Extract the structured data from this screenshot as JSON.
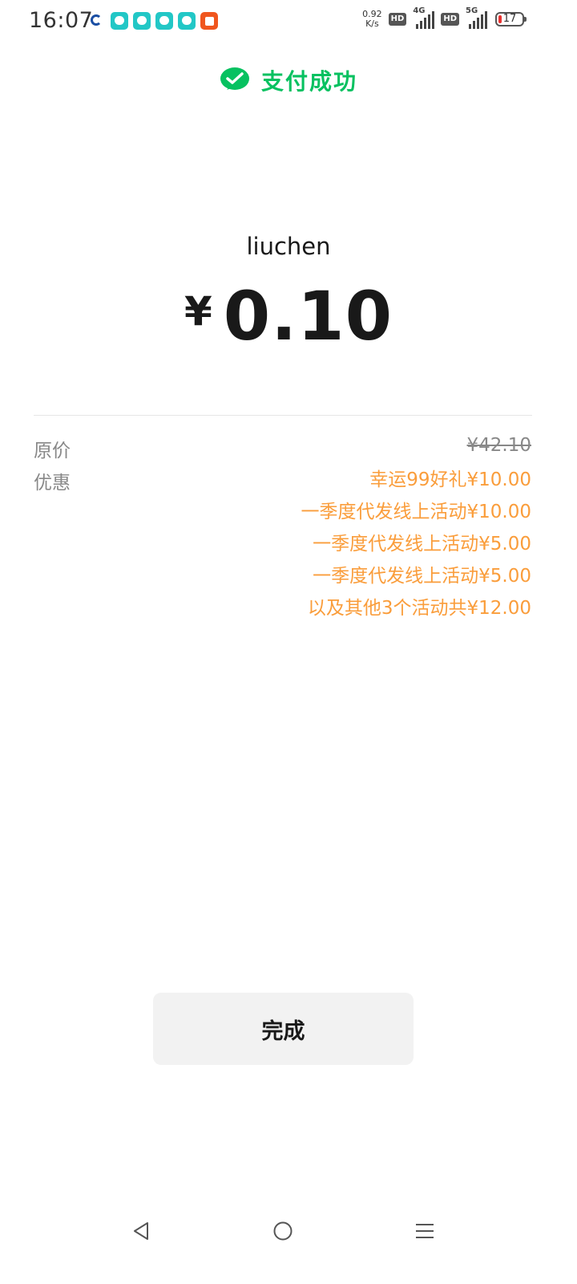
{
  "status_bar": {
    "time": "16:07",
    "net_speed_value": "0.92",
    "net_speed_unit": "K/s",
    "hd1": "HD",
    "network1": "4G",
    "hd2": "HD",
    "network2": "5G",
    "battery": "17"
  },
  "header": {
    "title": "支付成功",
    "icon": "wechat-pay-icon",
    "accent_color": "#07c160"
  },
  "payment": {
    "merchant": "liuchen",
    "currency": "¥",
    "amount": "0.10"
  },
  "details": {
    "original_label": "原价",
    "original_price": "¥42.10",
    "discount_label": "优惠",
    "discount_color": "#fa9d3b",
    "discounts": [
      "幸运99好礼¥10.00",
      "一季度代发线上活动¥10.00",
      "一季度代发线上活动¥5.00",
      "一季度代发线上活动¥5.00",
      "以及其他3个活动共¥12.00"
    ]
  },
  "actions": {
    "done_label": "完成"
  },
  "nav": {
    "back_icon": "back-triangle-icon",
    "home_icon": "home-circle-icon",
    "menu_icon": "menu-lines-icon"
  }
}
